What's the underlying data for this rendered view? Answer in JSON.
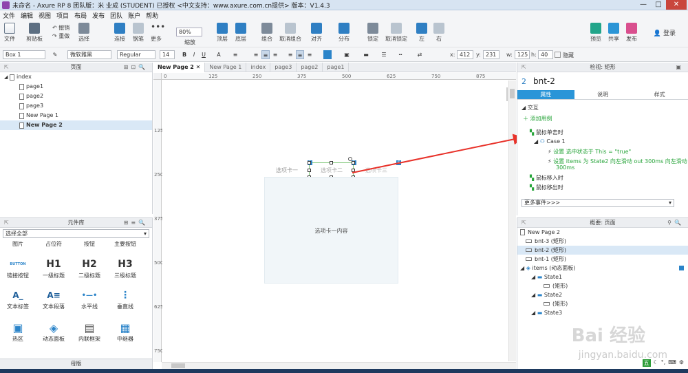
{
  "titlebar": {
    "title": "未命名 - Axure RP 8 团队版：米 业成 (STUDENT) 已授权 <中文支持：www.axure.com.cn提供> 版本：V1.4.3",
    "ghost": "www.axure.com.cn提供   版本：V1.4.3",
    "minimize": "—",
    "maximize": "□",
    "close": "✕"
  },
  "menu": [
    "文件",
    "编辑",
    "视图",
    "项目",
    "布局",
    "发布",
    "团队",
    "账户",
    "帮助"
  ],
  "toolbar": {
    "file": "文件",
    "clipboard": "剪贴板",
    "undo": "撤销",
    "redo": "重做",
    "select": "选择",
    "connect": "连接",
    "pen": "钢笔",
    "more": "更多",
    "zoom_value": "80%",
    "zoom_label": "缩放",
    "top": "顶层",
    "bottom": "底层",
    "group": "组合",
    "ungroup": "取消组合",
    "align": "对齐",
    "distribute": "分布",
    "lock": "锁定",
    "unlock": "取消锁定",
    "left": "左",
    "right": "右",
    "preview": "预览",
    "share": "共享",
    "publish": "发布",
    "login": "登录"
  },
  "format": {
    "style": "Box 1",
    "font": "微软雅黑",
    "weight": "Regular",
    "size": "14",
    "bold": "B",
    "italic": "I",
    "underline": "U",
    "x_label": "x:",
    "x": "412",
    "y_label": "y:",
    "y": "231",
    "w_label": "w:",
    "w": "125",
    "h_label": "h:",
    "h": "40",
    "hidden": "隐藏"
  },
  "pages": {
    "header": "页面",
    "root": "index",
    "items": [
      "page1",
      "page2",
      "page3",
      "New Page 1",
      "New Page 2"
    ]
  },
  "widgets": {
    "header": "元件库",
    "filter": "选择全部",
    "row1": [
      "图片",
      "占位符",
      "按钮",
      "主要按钮"
    ],
    "row2": [
      {
        "icon": "BUTTON",
        "label": "链接按钮"
      },
      {
        "icon": "H1",
        "label": "一级标题"
      },
      {
        "icon": "H2",
        "label": "二级标题"
      },
      {
        "icon": "H3",
        "label": "三级标题"
      }
    ],
    "row3": [
      {
        "icon": "A_",
        "label": "文本标签"
      },
      {
        "icon": "A≡",
        "label": "文本段落"
      },
      {
        "icon": "•—•",
        "label": "水平线"
      },
      {
        "icon": "⋮",
        "label": "垂直线"
      }
    ],
    "row4": [
      {
        "icon": "▣",
        "label": "热区"
      },
      {
        "icon": "◈",
        "label": "动态面板"
      },
      {
        "icon": "▤",
        "label": "内联框架"
      },
      {
        "icon": "▦",
        "label": "中继器"
      }
    ]
  },
  "masters": {
    "header": "母版"
  },
  "tabs": [
    "New Page 2",
    "New Page 1",
    "index",
    "page3",
    "page2",
    "page1"
  ],
  "ruler": {
    "h": [
      "0",
      "125",
      "250",
      "375",
      "500",
      "625",
      "750",
      "875"
    ],
    "v": [
      "125",
      "250",
      "375",
      "500",
      "625",
      "750"
    ]
  },
  "canvas": {
    "tab1": "选项卡一",
    "tab2": "选项卡二",
    "tab3": "选项卡三",
    "content": "选项卡一内容",
    "badge1": "1",
    "badge2": "2",
    "badge_right": "6"
  },
  "inspector": {
    "header": "检视: 矩形",
    "number": "2",
    "name": "bnt-2",
    "tabs": [
      "属性",
      "说明",
      "样式"
    ],
    "section": "交互",
    "add_case": "添加用例",
    "event_click": "鼠标单击时",
    "case": "Case 1",
    "action1": "设置 选中状态于 This = \"true\"",
    "action2": "设置 items 为 State2 向左滑动 out 300ms 向左滑动 in",
    "action2_cont": "300ms",
    "event_enter": "鼠标移入时",
    "event_leave": "鼠标移出时",
    "more_events": "更多事件>>>"
  },
  "outline": {
    "header": "概要: 页面",
    "page": "New Page 2",
    "rows": [
      {
        "label": "bnt-3 (矩形)",
        "indent": 0,
        "selected": false
      },
      {
        "label": "bnt-2 (矩形)",
        "indent": 0,
        "selected": true
      },
      {
        "label": "bnt-1 (矩形)",
        "indent": 0,
        "selected": false
      },
      {
        "label": "items (动态面板)",
        "indent": 0,
        "selected": false
      },
      {
        "label": "State1",
        "indent": 1,
        "selected": false
      },
      {
        "label": "(矩形)",
        "indent": 2,
        "selected": false
      },
      {
        "label": "State2",
        "indent": 1,
        "selected": false
      },
      {
        "label": "(矩形)",
        "indent": 2,
        "selected": false
      },
      {
        "label": "State3",
        "indent": 1,
        "selected": false
      }
    ]
  },
  "watermark": {
    "text": "Bai 经验",
    "sub": "jingyan.baidu.com"
  },
  "tray": {
    "ime": "五"
  }
}
